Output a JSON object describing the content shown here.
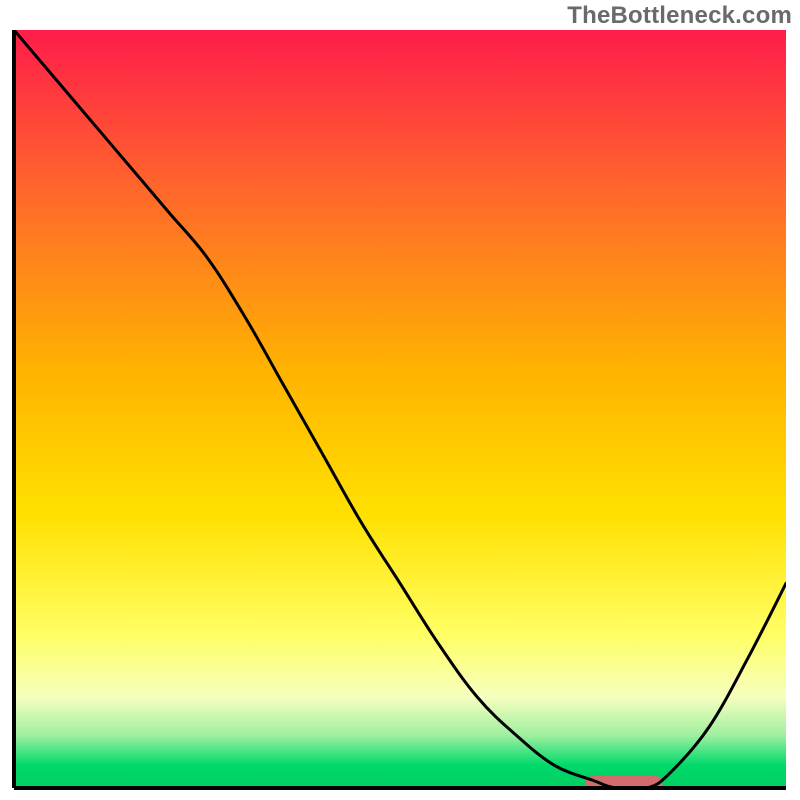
{
  "watermark": "TheBottleneck.com",
  "colors": {
    "gradient_top": "#ff1c4b",
    "gradient_mid1": "#ff6a2a",
    "gradient_mid2": "#ffb300",
    "gradient_mid3": "#ffe100",
    "gradient_low": "#ffff66",
    "gradient_band_pale": "#f6ffbf",
    "gradient_band_green1": "#a0f0a0",
    "gradient_band_green2": "#00d96b",
    "gradient_bottom": "#00cf60",
    "curve_stroke": "#000000",
    "marker_fill": "#d16d6d",
    "frame_stroke": "#000000",
    "bg_outside": "#ffffff"
  },
  "chart_data": {
    "type": "line",
    "title": "",
    "xlabel": "",
    "ylabel": "",
    "xlim": [
      0,
      100
    ],
    "ylim": [
      0,
      100
    ],
    "x": [
      0,
      5,
      10,
      15,
      20,
      25,
      30,
      35,
      40,
      45,
      50,
      55,
      60,
      65,
      70,
      75,
      78,
      82,
      85,
      90,
      95,
      100
    ],
    "values": [
      100,
      94,
      88,
      82,
      76,
      70,
      62,
      53,
      44,
      35,
      27,
      19,
      12,
      7,
      3,
      1,
      0,
      0,
      2,
      8,
      17,
      27
    ],
    "optimal_band": {
      "x_start": 74,
      "x_end": 84,
      "y": 0
    },
    "notes": "Vertical gradient background: red (top) → orange → yellow → pale → green (bottom). Single black curve with a minimum near x≈78–82 and a short pink marker segment at the minimum."
  }
}
